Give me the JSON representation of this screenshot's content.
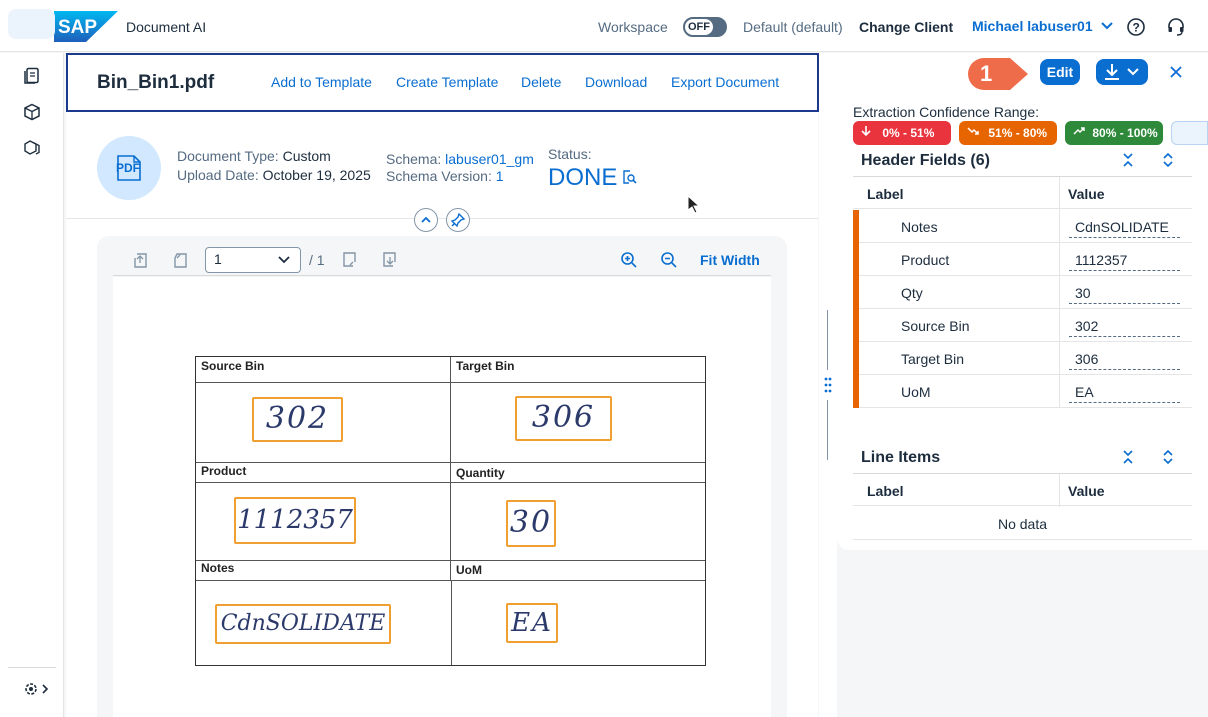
{
  "shell": {
    "app_name": "Document AI",
    "workspace_label": "Workspace",
    "toggle_state": "OFF",
    "default_label": "Default (default)",
    "change_client": "Change Client",
    "user_name": "Michael labuser01"
  },
  "doc": {
    "file_name": "Bin_Bin1.pdf",
    "actions": [
      "Add to Template",
      "Create Template",
      "Delete",
      "Download",
      "Export Document"
    ],
    "doc_type_label": "Document Type:",
    "doc_type_value": "Custom",
    "upload_label": "Upload Date:",
    "upload_value": "October 19, 2025",
    "schema_label": "Schema:",
    "schema_value": "labuser01_gm",
    "schema_version_label": "Schema Version:",
    "schema_version_value": "1",
    "status_label": "Status:",
    "status_value": "DONE",
    "pdf_badge": "PDF"
  },
  "viewer": {
    "page_current": "1",
    "page_total": "/ 1",
    "fit_width": "Fit Width"
  },
  "form": {
    "labels": [
      "Source Bin",
      "Target Bin",
      "Product",
      "Quantity",
      "Notes",
      "UoM"
    ],
    "handwriting": [
      "302",
      "306",
      "1112357",
      "30",
      "CdnSOLIDATE",
      "EA"
    ]
  },
  "right": {
    "callout_number": "1",
    "edit_label": "Edit",
    "confidence_title": "Extraction Confidence Range:",
    "legend": [
      {
        "label": "0% - 51%",
        "color": "#e9343d"
      },
      {
        "label": "51% - 80%",
        "color": "#e76500"
      },
      {
        "label": "80% - 100%",
        "color": "#2e8a3a"
      }
    ],
    "header_fields_title": "Header Fields (6)",
    "col_label": "Label",
    "col_value": "Value",
    "fields": [
      {
        "label": "Notes",
        "value": "CdnSOLIDATE"
      },
      {
        "label": "Product",
        "value": "1112357"
      },
      {
        "label": "Qty",
        "value": "30"
      },
      {
        "label": "Source Bin",
        "value": "302"
      },
      {
        "label": "Target Bin",
        "value": "306"
      },
      {
        "label": "UoM",
        "value": "EA"
      }
    ],
    "line_items_title": "Line Items",
    "no_data": "No data"
  },
  "colors": {
    "accent": "#0a6ed1",
    "confidence_medium": "#e76500",
    "selection_border": "#1b3a8e"
  }
}
